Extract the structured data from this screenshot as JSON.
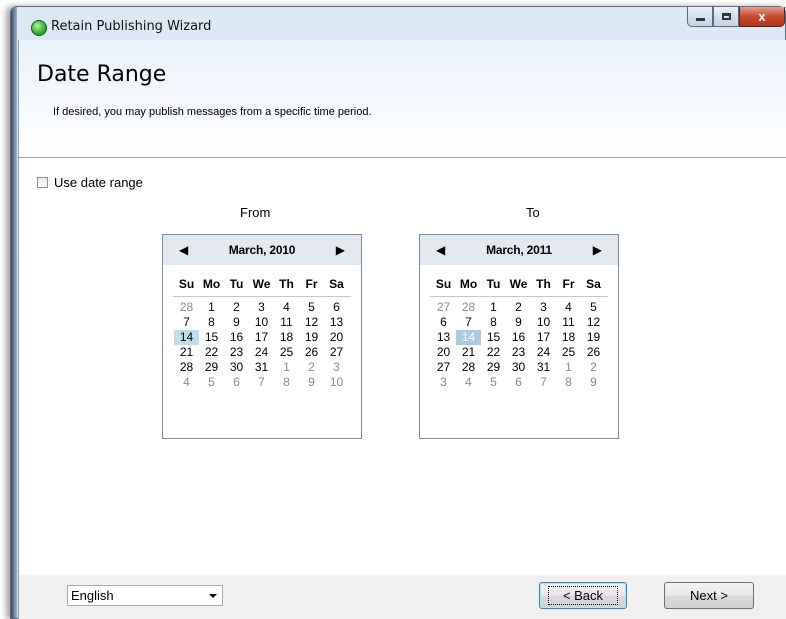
{
  "window": {
    "title": "Retain Publishing Wizard",
    "controls": {
      "minimize_icon": "minimize-icon",
      "maximize_icon": "maximize-icon",
      "close_label": "x"
    }
  },
  "header": {
    "title": "Date Range",
    "subtitle": "If desired, you may publish messages from a specific time period."
  },
  "options": {
    "use_date_range": {
      "label": "Use date range",
      "checked": false
    }
  },
  "calendars": {
    "from": {
      "caption": "From",
      "month_label": "March, 2010",
      "prev_glyph": "◀",
      "next_glyph": "▶",
      "weekdays": [
        "Su",
        "Mo",
        "Tu",
        "We",
        "Th",
        "Fr",
        "Sa"
      ],
      "weeks": [
        [
          {
            "d": "28",
            "o": true
          },
          {
            "d": "1"
          },
          {
            "d": "2"
          },
          {
            "d": "3"
          },
          {
            "d": "4"
          },
          {
            "d": "5"
          },
          {
            "d": "6"
          }
        ],
        [
          {
            "d": "7"
          },
          {
            "d": "8"
          },
          {
            "d": "9"
          },
          {
            "d": "10"
          },
          {
            "d": "11"
          },
          {
            "d": "12"
          },
          {
            "d": "13"
          }
        ],
        [
          {
            "d": "14",
            "t": true
          },
          {
            "d": "15"
          },
          {
            "d": "16"
          },
          {
            "d": "17"
          },
          {
            "d": "18"
          },
          {
            "d": "19"
          },
          {
            "d": "20"
          }
        ],
        [
          {
            "d": "21"
          },
          {
            "d": "22"
          },
          {
            "d": "23"
          },
          {
            "d": "24"
          },
          {
            "d": "25"
          },
          {
            "d": "26"
          },
          {
            "d": "27"
          }
        ],
        [
          {
            "d": "28"
          },
          {
            "d": "29"
          },
          {
            "d": "30"
          },
          {
            "d": "31"
          },
          {
            "d": "1",
            "o": true
          },
          {
            "d": "2",
            "o": true
          },
          {
            "d": "3",
            "o": true
          }
        ],
        [
          {
            "d": "4",
            "o": true
          },
          {
            "d": "5",
            "o": true
          },
          {
            "d": "6",
            "o": true
          },
          {
            "d": "7",
            "o": true
          },
          {
            "d": "8",
            "o": true
          },
          {
            "d": "9",
            "o": true
          },
          {
            "d": "10",
            "o": true
          }
        ]
      ]
    },
    "to": {
      "caption": "To",
      "month_label": "March, 2011",
      "prev_glyph": "◀",
      "next_glyph": "▶",
      "weekdays": [
        "Su",
        "Mo",
        "Tu",
        "We",
        "Th",
        "Fr",
        "Sa"
      ],
      "weeks": [
        [
          {
            "d": "27",
            "o": true
          },
          {
            "d": "28",
            "o": true
          },
          {
            "d": "1"
          },
          {
            "d": "2"
          },
          {
            "d": "3"
          },
          {
            "d": "4"
          },
          {
            "d": "5"
          }
        ],
        [
          {
            "d": "6"
          },
          {
            "d": "7"
          },
          {
            "d": "8"
          },
          {
            "d": "9"
          },
          {
            "d": "10"
          },
          {
            "d": "11"
          },
          {
            "d": "12"
          }
        ],
        [
          {
            "d": "13"
          },
          {
            "d": "14",
            "t": true,
            "dim": true
          },
          {
            "d": "15"
          },
          {
            "d": "16"
          },
          {
            "d": "17"
          },
          {
            "d": "18"
          },
          {
            "d": "19"
          }
        ],
        [
          {
            "d": "20"
          },
          {
            "d": "21"
          },
          {
            "d": "22"
          },
          {
            "d": "23"
          },
          {
            "d": "24"
          },
          {
            "d": "25"
          },
          {
            "d": "26"
          }
        ],
        [
          {
            "d": "27"
          },
          {
            "d": "28"
          },
          {
            "d": "29"
          },
          {
            "d": "30"
          },
          {
            "d": "31"
          },
          {
            "d": "1",
            "o": true
          },
          {
            "d": "2",
            "o": true
          }
        ],
        [
          {
            "d": "3",
            "o": true
          },
          {
            "d": "4",
            "o": true
          },
          {
            "d": "5",
            "o": true
          },
          {
            "d": "6",
            "o": true
          },
          {
            "d": "7",
            "o": true
          },
          {
            "d": "8",
            "o": true
          },
          {
            "d": "9",
            "o": true
          }
        ]
      ]
    }
  },
  "footer": {
    "language": {
      "selected": "English"
    },
    "back_label": "< Back",
    "next_label": "Next >"
  },
  "colors": {
    "today_highlight": "#c1dce8",
    "header_gradient_top": "#e9f1f9",
    "footer_background": "#f0f0f0",
    "close_button": "#c94a2f"
  }
}
